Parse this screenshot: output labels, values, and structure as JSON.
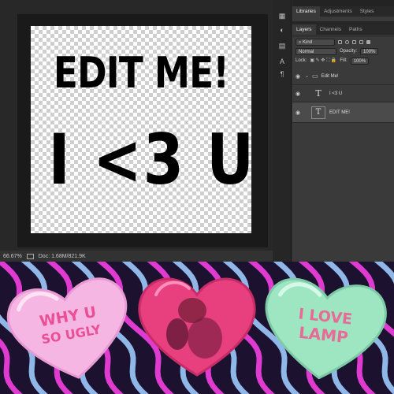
{
  "canvas": {
    "line1": "EDIT ME!",
    "line2": "I <3 U"
  },
  "status": {
    "zoom": "66.67%",
    "doc_info": "Doc: 1.68M/821.9K"
  },
  "panels": {
    "top_tabs": [
      "Libraries",
      "Adjustments",
      "Styles"
    ],
    "layer_tabs": [
      "Layers",
      "Channels",
      "Paths"
    ],
    "filter_kind": "⌕ Kind",
    "blend_mode": "Normal",
    "opacity_label": "Opacity:",
    "opacity_value": "100%",
    "lock_label": "Lock:",
    "fill_label": "Fill:",
    "fill_value": "100%",
    "layers": [
      {
        "name": "Edit Me!",
        "type": "group"
      },
      {
        "name": "I <3 U",
        "type": "text"
      },
      {
        "name": "EDIT ME!",
        "type": "text"
      }
    ],
    "footer_icons": [
      "link-icon",
      "fx-icon",
      "mask-icon",
      "adjustment-icon",
      "folder-icon",
      "new-layer-icon",
      "trash-icon"
    ]
  },
  "poster": {
    "left_heart": [
      "WHY U",
      "SO UGLY"
    ],
    "right_heart": [
      "I LOVE",
      "LAMP"
    ],
    "colors": {
      "background": "#1c1230",
      "wave_pink": "#e03bd0",
      "wave_blue": "#8fb8e8",
      "left_heart": "#f6b6e4",
      "left_text": "#e84f94",
      "center_heart": "#e8407f",
      "right_heart": "#9ee6c2",
      "right_text": "#e86b97"
    }
  }
}
